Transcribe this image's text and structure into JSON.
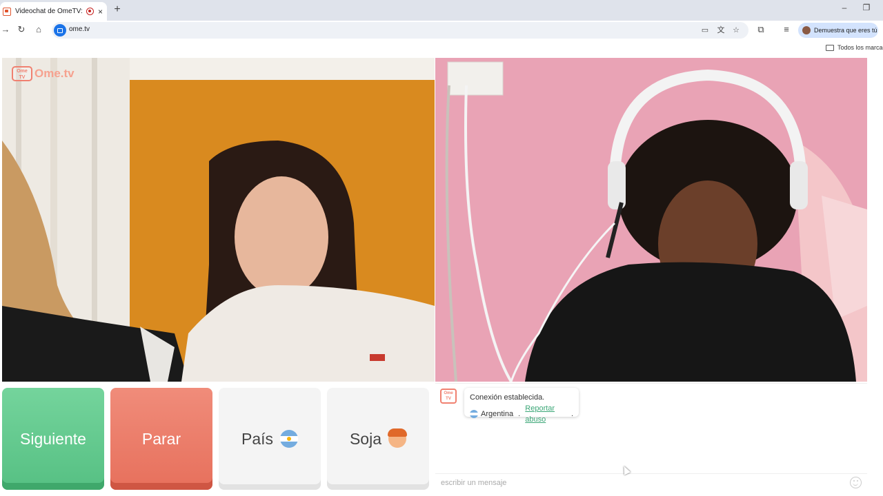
{
  "browser": {
    "tab_title": "Videochat de OmeTV: una",
    "tab_close": "×",
    "new_tab": "+",
    "url": "ome.tv",
    "profile_label": "Demuestra que eres tú",
    "bookmarks_folder": "Todos los marcad",
    "window_controls": {
      "minimize": "–",
      "maximize": "❐"
    }
  },
  "page": {
    "logo_text": "Ome.tv",
    "logo_tv_text": "Ome TV",
    "buttons": {
      "next": "Siguiente",
      "stop": "Parar",
      "country": "País",
      "gender": "Soja"
    },
    "chat": {
      "system_logo": "Ome TV",
      "message_line1": "Conexión establecida.",
      "country": "Argentina",
      "separator": " . ",
      "report_link": "Reportar abuso",
      "report_suffix": ".",
      "input_placeholder": "escribir un mensaje"
    }
  },
  "colors": {
    "next_green": "#5cc48a",
    "stop_red": "#ea7561",
    "link_green": "#3aa676",
    "brand_coral": "#f08070"
  },
  "icons": [
    "forward-icon",
    "reload-icon",
    "home-icon",
    "site-info-icon",
    "cast-icon",
    "translate-icon",
    "star-icon",
    "extensions-icon",
    "reading-list-icon",
    "folder-icon",
    "emoji-icon",
    "argentina-flag-icon",
    "boy-face-icon"
  ]
}
